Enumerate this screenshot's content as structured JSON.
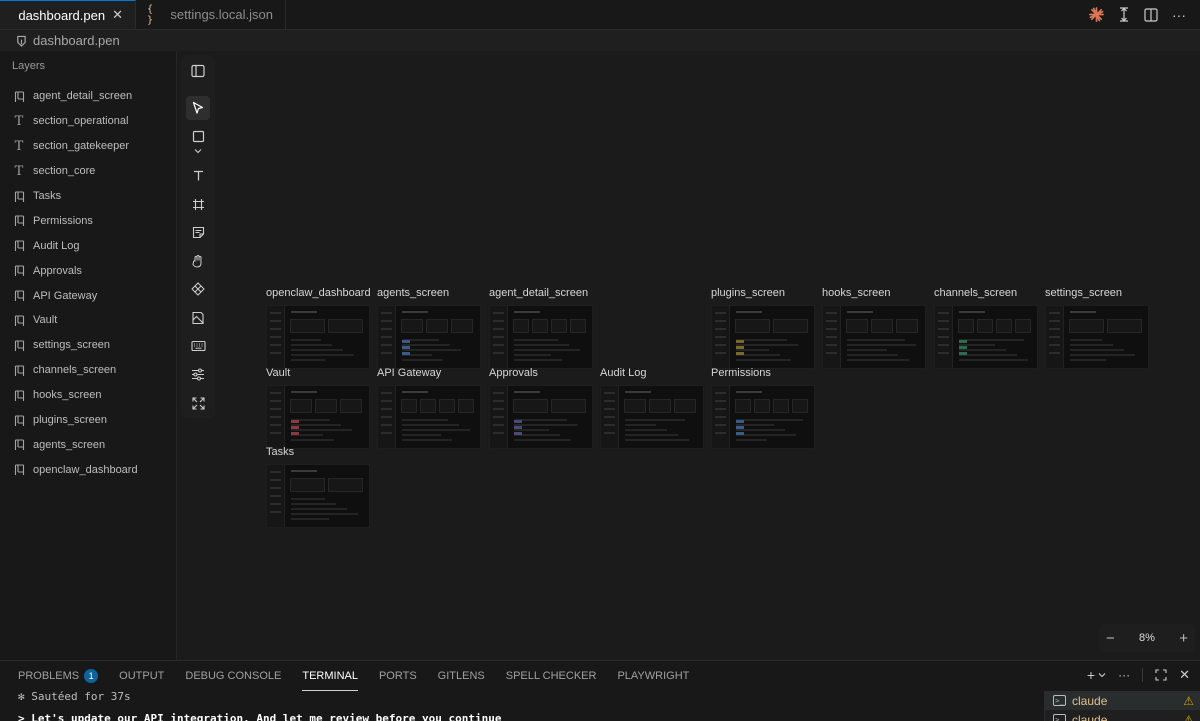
{
  "tabs": [
    {
      "label": "dashboard.pen",
      "active": true
    },
    {
      "label": "settings.local.json",
      "active": false
    }
  ],
  "breadcrumb": {
    "file": "dashboard.pen"
  },
  "layers_panel": {
    "title": "Layers",
    "items": [
      {
        "label": "agent_detail_screen",
        "icon": "frame-icon"
      },
      {
        "label": "section_operational",
        "icon": "text-icon"
      },
      {
        "label": "section_gatekeeper",
        "icon": "text-icon"
      },
      {
        "label": "section_core",
        "icon": "text-icon"
      },
      {
        "label": "Tasks",
        "icon": "frame-icon"
      },
      {
        "label": "Permissions",
        "icon": "frame-icon"
      },
      {
        "label": "Audit Log",
        "icon": "frame-icon"
      },
      {
        "label": "Approvals",
        "icon": "frame-icon"
      },
      {
        "label": "API Gateway",
        "icon": "frame-icon"
      },
      {
        "label": "Vault",
        "icon": "frame-icon"
      },
      {
        "label": "settings_screen",
        "icon": "frame-icon"
      },
      {
        "label": "channels_screen",
        "icon": "frame-icon"
      },
      {
        "label": "hooks_screen",
        "icon": "frame-icon"
      },
      {
        "label": "plugins_screen",
        "icon": "frame-icon"
      },
      {
        "label": "agents_screen",
        "icon": "frame-icon"
      },
      {
        "label": "openclaw_dashboard",
        "icon": "frame-icon"
      }
    ]
  },
  "toolbar": {
    "tools": [
      "sidebar-toggle-icon",
      "pointer-icon",
      "rectangle-icon",
      "chevron-down-icon",
      "text-tool-icon",
      "frame-tool-icon",
      "note-icon",
      "hand-icon",
      "component-icon",
      "image-icon",
      "keyboard-icon",
      "sliders-icon",
      "fit-icon"
    ]
  },
  "canvas": {
    "frames": [
      {
        "label": "openclaw_dashboard"
      },
      {
        "label": "agents_screen"
      },
      {
        "label": "agent_detail_screen"
      },
      {
        "label": "plugins_screen"
      },
      {
        "label": "hooks_screen"
      },
      {
        "label": "channels_screen"
      },
      {
        "label": "settings_screen"
      },
      {
        "label": "Vault"
      },
      {
        "label": "API Gateway"
      },
      {
        "label": "Approvals"
      },
      {
        "label": "Audit Log"
      },
      {
        "label": "Permissions"
      },
      {
        "label": "Tasks"
      }
    ]
  },
  "zoom": {
    "minus": "−",
    "value": "8%",
    "plus": "+"
  },
  "panel": {
    "tabs": [
      {
        "label": "PROBLEMS",
        "badge": "1"
      },
      {
        "label": "OUTPUT"
      },
      {
        "label": "DEBUG CONSOLE"
      },
      {
        "label": "TERMINAL",
        "active": true
      },
      {
        "label": "PORTS"
      },
      {
        "label": "GITLENS"
      },
      {
        "label": "SPELL CHECKER"
      },
      {
        "label": "PLAYWRIGHT"
      }
    ],
    "terminal_lines": [
      "✻ Sautéed for 37s",
      "> Let's update our API integration. And let me review before you continue"
    ],
    "terminals": [
      {
        "label": "claude"
      },
      {
        "label": "claude"
      }
    ]
  },
  "colors": {
    "accent": "#0078d4",
    "claude_logo": "#d97757",
    "warning": "#cca700",
    "terminal_name": "#e2c08d"
  }
}
